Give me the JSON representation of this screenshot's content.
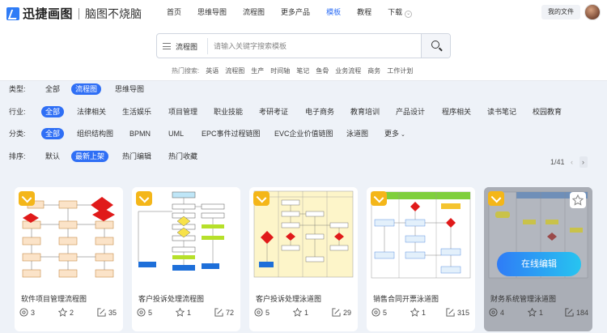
{
  "header": {
    "brand": "迅捷画图",
    "slogan": "脑图不烧脑",
    "nav": [
      "首页",
      "思维导图",
      "流程图",
      "更多产品",
      "模板",
      "教程",
      "下载"
    ],
    "nav_active": "模板",
    "my_files": "我的文件"
  },
  "search": {
    "category": "流程图",
    "placeholder": "请输入关键字搜索模板"
  },
  "hot": {
    "label": "热门搜索:",
    "terms": [
      "英语",
      "流程图",
      "生产",
      "时间轴",
      "笔记",
      "鱼骨",
      "业务流程",
      "商务",
      "工作计划"
    ]
  },
  "filters": {
    "type": {
      "label": "类型:",
      "options": [
        "全部",
        "流程图",
        "思维导图"
      ],
      "selected": "流程图"
    },
    "industry": {
      "label": "行业:",
      "options": [
        "全部",
        "法律相关",
        "生活娱乐",
        "项目管理",
        "职业技能",
        "考研考证",
        "电子商务",
        "教育培训",
        "产品设计",
        "程序相关",
        "读书笔记",
        "校园教育"
      ],
      "selected": "全部"
    },
    "category": {
      "label": "分类:",
      "options": [
        "全部",
        "组织结构图",
        "BPMN",
        "UML",
        "EPC事件过程链图",
        "EVC企业价值链图",
        "泳道图",
        "更多"
      ],
      "selected": "全部"
    },
    "sort": {
      "label": "排序:",
      "options": [
        "默认",
        "最新上架",
        "热门编辑",
        "热门收藏"
      ],
      "selected": "最新上架"
    }
  },
  "pager": {
    "text": "1/41",
    "prev": "‹",
    "next": "›"
  },
  "cards": [
    {
      "title": "软件项目管理流程图",
      "views": "3",
      "likes": "2",
      "edits": "35"
    },
    {
      "title": "客户投诉处理流程图",
      "views": "5",
      "likes": "1",
      "edits": "72"
    },
    {
      "title": "客户投诉处理泳道图",
      "views": "5",
      "likes": "1",
      "edits": "29"
    },
    {
      "title": "销售合同开票泳道图",
      "views": "5",
      "likes": "1",
      "edits": "315"
    },
    {
      "title": "财务系统管理泳道图",
      "views": "4",
      "likes": "1",
      "edits": "184",
      "button": "在线编辑"
    }
  ],
  "colors": {
    "accent": "#2f6ff5",
    "crown": "#f4b619"
  }
}
